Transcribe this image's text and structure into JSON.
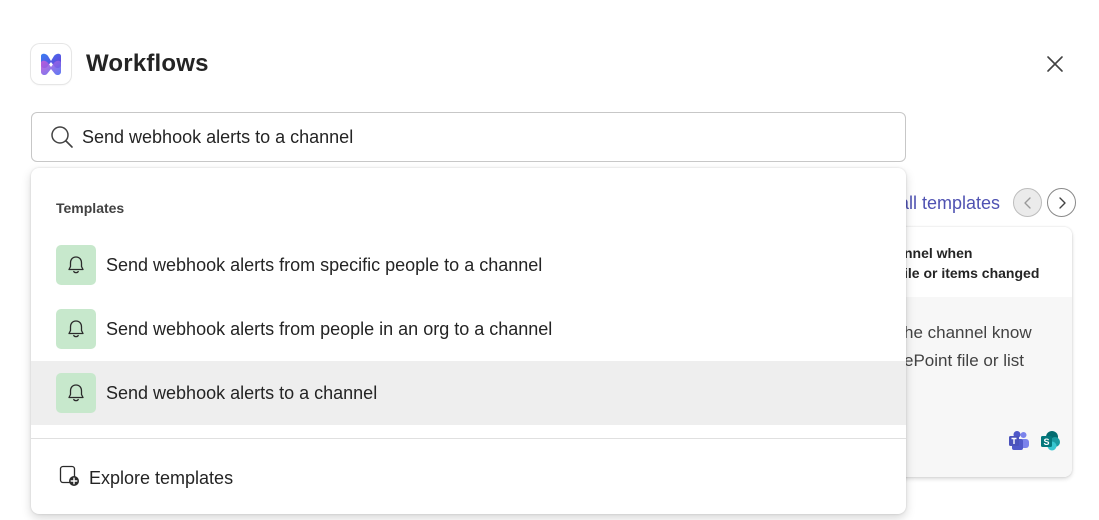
{
  "header": {
    "title": "Workflows",
    "icon": "workflows-app-icon"
  },
  "search": {
    "value": "Send webhook alerts to a channel",
    "placeholder": "Search"
  },
  "background": {
    "see_all_label": "See all templates",
    "card": {
      "title_line1": "nnel when",
      "title_line2": "ile or items changed",
      "desc_line1": "he channel know",
      "desc_line2": "ePoint file or list",
      "icons": [
        "teams-icon",
        "sharepoint-icon"
      ]
    }
  },
  "dropdown": {
    "section_label": "Templates",
    "results": [
      {
        "label": "Send webhook alerts from specific people to a channel",
        "icon": "bell-icon"
      },
      {
        "label": "Send webhook alerts from people in an org to a channel",
        "icon": "bell-icon"
      },
      {
        "label": "Send webhook alerts to a channel",
        "icon": "bell-icon",
        "highlighted": true
      }
    ],
    "explore_label": "Explore templates"
  },
  "colors": {
    "accent": "#4f52b2",
    "bell_badge": "#c7e8cc",
    "highlight_row": "#eeeeee"
  }
}
